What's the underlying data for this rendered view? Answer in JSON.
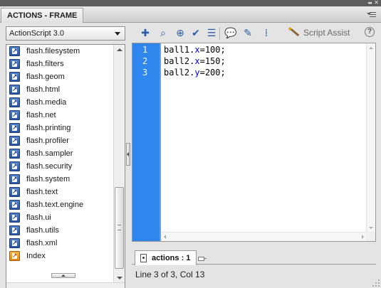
{
  "panel": {
    "title": "ACTIONS - FRAME",
    "collapse_icon": "double-left-arrows",
    "close_icon": "x"
  },
  "language_selector": {
    "value": "ActionScript 3.0"
  },
  "toolbox": {
    "items": [
      {
        "label": "flash.filesystem",
        "icon": "book-icon"
      },
      {
        "label": "flash.filters",
        "icon": "book-icon"
      },
      {
        "label": "flash.geom",
        "icon": "book-icon"
      },
      {
        "label": "flash.html",
        "icon": "book-icon"
      },
      {
        "label": "flash.media",
        "icon": "book-icon"
      },
      {
        "label": "flash.net",
        "icon": "book-icon"
      },
      {
        "label": "flash.printing",
        "icon": "book-icon"
      },
      {
        "label": "flash.profiler",
        "icon": "book-icon"
      },
      {
        "label": "flash.sampler",
        "icon": "book-icon"
      },
      {
        "label": "flash.security",
        "icon": "book-icon"
      },
      {
        "label": "flash.system",
        "icon": "book-icon"
      },
      {
        "label": "flash.text",
        "icon": "book-icon"
      },
      {
        "label": "flash.text.engine",
        "icon": "book-icon"
      },
      {
        "label": "flash.ui",
        "icon": "book-icon"
      },
      {
        "label": "flash.utils",
        "icon": "book-icon"
      },
      {
        "label": "flash.xml",
        "icon": "book-icon"
      },
      {
        "label": "Index",
        "icon": "index-book-icon"
      }
    ]
  },
  "toolbar": {
    "buttons": [
      {
        "name": "add-statement-button",
        "icon": "plus-icon",
        "glyph": "✚"
      },
      {
        "name": "find-button",
        "icon": "magnifier-icon",
        "glyph": "⌕"
      },
      {
        "name": "insert-target-path-button",
        "icon": "crosshair-icon",
        "glyph": "⊕"
      },
      {
        "name": "check-syntax-button",
        "icon": "checkmark-icon",
        "glyph": "✔"
      },
      {
        "name": "auto-format-button",
        "icon": "lines-icon",
        "glyph": "☰"
      },
      {
        "name": "show-code-hint-button",
        "icon": "speech-bubble-icon",
        "glyph": "💬"
      },
      {
        "name": "debug-options-button",
        "icon": "bug-icon",
        "glyph": "✎"
      },
      {
        "name": "collapse-between-braces-button",
        "icon": "braces-icon",
        "glyph": "⁞"
      }
    ],
    "script_assist_label": "Script Assist",
    "help_glyph": "?"
  },
  "editor": {
    "lines": [
      {
        "num": "1",
        "obj": "ball1.",
        "prop": "x",
        "rest": "=100;"
      },
      {
        "num": "2",
        "obj": "ball2.",
        "prop": "x",
        "rest": "=150;"
      },
      {
        "num": "3",
        "obj": "ball2.",
        "prop": "y",
        "rest": "=200;"
      }
    ]
  },
  "tabs": {
    "active_label": "actions : 1"
  },
  "status": {
    "text": "Line 3 of 3, Col 13"
  },
  "colors": {
    "gutter": "#2f86ed",
    "property": "#0000c8",
    "toolbar_icon": "#2b5da8"
  }
}
